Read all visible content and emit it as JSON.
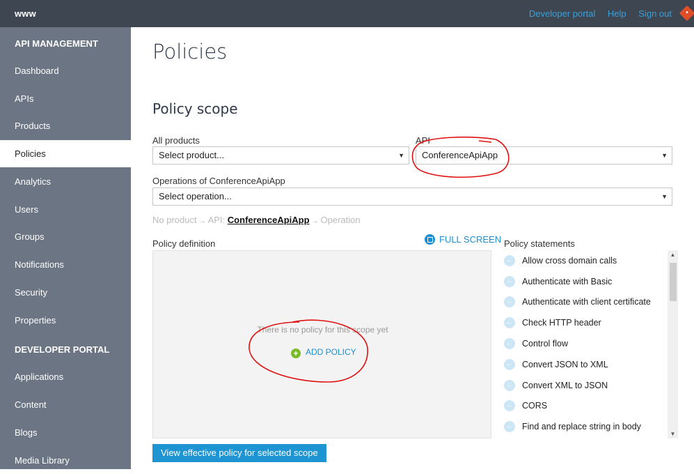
{
  "topbar": {
    "brand": "www",
    "links": [
      "Developer portal",
      "Help",
      "Sign out"
    ]
  },
  "sidebar": {
    "section1": "API MANAGEMENT",
    "items1": [
      "Dashboard",
      "APIs",
      "Products",
      "Policies",
      "Analytics",
      "Users",
      "Groups",
      "Notifications",
      "Security",
      "Properties"
    ],
    "section2": "DEVELOPER PORTAL",
    "items2": [
      "Applications",
      "Content",
      "Blogs",
      "Media Library"
    ],
    "active": "Policies"
  },
  "main": {
    "title": "Policies",
    "scope_title": "Policy scope",
    "products_label": "All products",
    "products_value": "Select product...",
    "api_label": "API",
    "api_value": "ConferenceApiApp",
    "ops_label": "Operations of ConferenceApiApp",
    "ops_value": "Select operation...",
    "scope_path": {
      "product": "No product",
      "api_prefix": "API:",
      "api": "ConferenceApiApp",
      "operation": "Operation"
    },
    "policy_def_label": "Policy definition",
    "fullscreen": "FULL SCREEN",
    "no_policy": "There is no policy for this scope yet",
    "add_policy": "ADD POLICY",
    "statements_label": "Policy statements",
    "statements": [
      "Allow cross domain calls",
      "Authenticate with Basic",
      "Authenticate with client certificate",
      "Check HTTP header",
      "Control flow",
      "Convert JSON to XML",
      "Convert XML to JSON",
      "CORS",
      "Find and replace string in body"
    ],
    "view_button": "View effective policy for selected scope"
  },
  "colors": {
    "topbar": "#3e4652",
    "sidebar": "#6b7583",
    "accent": "#1e94d2",
    "annotation": "#e01010"
  }
}
